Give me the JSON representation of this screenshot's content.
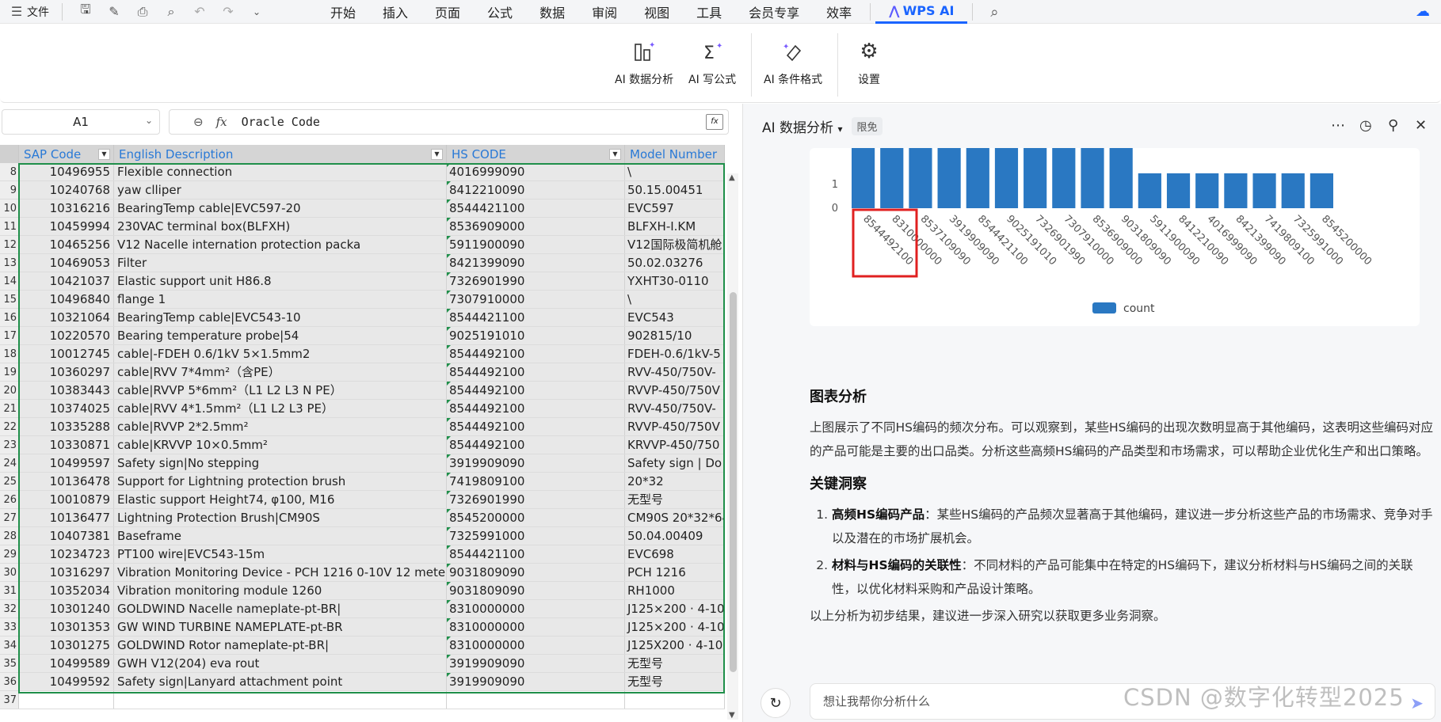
{
  "menubar": {
    "file_label": "文件",
    "tabs": [
      "开始",
      "插入",
      "页面",
      "公式",
      "数据",
      "审阅",
      "视图",
      "工具",
      "会员专享",
      "效率",
      "WPS AI"
    ],
    "active_tab": "WPS AI"
  },
  "ribbon": {
    "buttons": [
      {
        "label": "AI 数据分析",
        "icon": "ai-data-analysis-icon"
      },
      {
        "label": "AI 写公式",
        "icon": "ai-formula-icon"
      },
      {
        "label": "AI 条件格式",
        "icon": "ai-conditional-format-icon"
      },
      {
        "label": "设置",
        "icon": "gear-icon"
      }
    ]
  },
  "formula_bar": {
    "cell_ref": "A1",
    "fx_label": "fx",
    "value": "Oracle Code"
  },
  "sheet": {
    "columns": [
      "SAP Code",
      "English Description",
      "HS CODE",
      "Model Number"
    ],
    "rows": [
      {
        "n": "8",
        "sap": "10496955",
        "desc": "Flexible connection",
        "hs": "4016999090",
        "model": "\\"
      },
      {
        "n": "9",
        "sap": "10240768",
        "desc": "yaw clliper",
        "hs": "8412210090",
        "model": "50.15.00451"
      },
      {
        "n": "10",
        "sap": "10316216",
        "desc": "BearingTemp cable|EVC597-20",
        "hs": "8544421100",
        "model": "EVC597"
      },
      {
        "n": "11",
        "sap": "10459994",
        "desc": "230VAC terminal box(BLFXH)",
        "hs": "8536909000",
        "model": "BLFXH-Ⅰ.KM"
      },
      {
        "n": "12",
        "sap": "10465256",
        "desc": "V12 Nacelle internation protection packa",
        "hs": "5911900090",
        "model": "V12国际极简机舱"
      },
      {
        "n": "13",
        "sap": "10469053",
        "desc": "Filter",
        "hs": "8421399090",
        "model": "50.02.03276"
      },
      {
        "n": "14",
        "sap": "10421037",
        "desc": "Elastic support unit H86.8",
        "hs": "7326901990",
        "model": "YXHT30-0110"
      },
      {
        "n": "15",
        "sap": "10496840",
        "desc": "flange 1",
        "hs": "7307910000",
        "model": "\\"
      },
      {
        "n": "16",
        "sap": "10321064",
        "desc": "BearingTemp cable|EVC543-10",
        "hs": "8544421100",
        "model": "EVC543"
      },
      {
        "n": "17",
        "sap": "10220570",
        "desc": "Bearing temperature probe|54",
        "hs": "9025191010",
        "model": "902815/10"
      },
      {
        "n": "18",
        "sap": "10012745",
        "desc": "cable|-FDEH 0.6/1kV 5×1.5mm2",
        "hs": "8544492100",
        "model": "FDEH-0.6/1kV-5"
      },
      {
        "n": "19",
        "sap": "10360297",
        "desc": "cable|RVV 7*4mm²（含PE）",
        "hs": "8544492100",
        "model": "RVV-450/750V-"
      },
      {
        "n": "20",
        "sap": "10383443",
        "desc": "cable|RVVP 5*6mm²（L1 L2 L3 N PE）",
        "hs": "8544492100",
        "model": "RVVP-450/750V"
      },
      {
        "n": "21",
        "sap": "10374025",
        "desc": "cable|RVV 4*1.5mm²（L1 L2 L3 PE）",
        "hs": "8544492100",
        "model": "RVV-450/750V-"
      },
      {
        "n": "22",
        "sap": "10335288",
        "desc": "cable|RVVP 2*2.5mm²",
        "hs": "8544492100",
        "model": "RVVP-450/750V"
      },
      {
        "n": "23",
        "sap": "10330871",
        "desc": "cable|KRVVP 10×0.5mm²",
        "hs": "8544492100",
        "model": "KRVVP-450/750"
      },
      {
        "n": "24",
        "sap": "10499597",
        "desc": "Safety sign|No stepping",
        "hs": "3919909090",
        "model": "Safety sign | Do"
      },
      {
        "n": "25",
        "sap": "10136478",
        "desc": "Support for Lightning protection brush",
        "hs": "7419809100",
        "model": "20*32"
      },
      {
        "n": "26",
        "sap": "10010879",
        "desc": "Elastic support Height74, φ100, M16",
        "hs": "7326901990",
        "model": "无型号"
      },
      {
        "n": "27",
        "sap": "10136477",
        "desc": "Lightning Protection Brush|CM90S",
        "hs": "8545200000",
        "model": "CM90S 20*32*64"
      },
      {
        "n": "28",
        "sap": "10407381",
        "desc": "Baseframe",
        "hs": "7325991000",
        "model": "50.04.00409"
      },
      {
        "n": "29",
        "sap": "10234723",
        "desc": "PT100 wire|EVC543-15m",
        "hs": "8544421100",
        "model": "EVC698"
      },
      {
        "n": "30",
        "sap": "10316297",
        "desc": "Vibration Monitoring Device - PCH 1216 0-10V 12 mete",
        "hs": "9031809090",
        "model": "PCH 1216"
      },
      {
        "n": "31",
        "sap": "10352034",
        "desc": "Vibration monitoring module 1260",
        "hs": "9031809090",
        "model": "RH1000"
      },
      {
        "n": "32",
        "sap": "10301240",
        "desc": "GOLDWIND Nacelle nameplate-pt-BR|",
        "hs": "8310000000",
        "model": "J125×200 · 4-10"
      },
      {
        "n": "33",
        "sap": "10301353",
        "desc": "GW WIND TURBINE NAMEPLATE-pt-BR",
        "hs": "8310000000",
        "model": "J125×200 · 4-10"
      },
      {
        "n": "34",
        "sap": "10301275",
        "desc": "GOLDWIND Rotor nameplate-pt-BR|",
        "hs": "8310000000",
        "model": "J125X200 · 4-10"
      },
      {
        "n": "35",
        "sap": "10499589",
        "desc": "GWH V12(204) eva rout",
        "hs": "3919909090",
        "model": "无型号"
      },
      {
        "n": "36",
        "sap": "10499592",
        "desc": "Safety sign|Lanyard attachment point",
        "hs": "3919909090",
        "model": "无型号"
      },
      {
        "n": "37",
        "sap": "",
        "desc": "",
        "hs": "",
        "model": ""
      }
    ]
  },
  "ai_panel": {
    "title": "AI 数据分析",
    "badge": "限免",
    "input_placeholder": "想让我帮你分析什么",
    "analysis_title": "图表分析",
    "analysis_text": "上图展示了不同HS编码的频次分布。可以观察到，某些HS编码的出现次数明显高于其他编码，这表明这些编码对应的产品可能是主要的出口品类。分析这些高频HS编码的产品类型和市场需求，可以帮助企业优化生产和出口策略。",
    "insights_title": "关键洞察",
    "insights": [
      {
        "bold": "高频HS编码产品",
        "text": "：某些HS编码的产品频次显著高于其他编码，建议进一步分析这些产品的市场需求、竞争对手以及潜在的市场扩展机会。"
      },
      {
        "bold": "材料与HS编码的关联性",
        "text": "：不同材料的产品可能集中在特定的HS编码下，建议分析材料与HS编码之间的关联性，以优化材料采购和产品设计策略。"
      }
    ],
    "conclusion": "以上分析为初步结果，建议进一步深入研究以获取更多业务洞察。"
  },
  "chart_data": {
    "type": "bar",
    "categories": [
      "8544492100",
      "8310000000",
      "8537109090",
      "3919909090",
      "8544421100",
      "9025191010",
      "7326901990",
      "7307910000",
      "8536909000",
      "9031809090",
      "5911900090",
      "8412210090",
      "4016999090",
      "8421399090",
      "7419809100",
      "7325991000",
      "8545200000"
    ],
    "series": [
      {
        "name": "count",
        "values": [
          2,
          2,
          2,
          2,
          2,
          2,
          2,
          2,
          2,
          2,
          1,
          1,
          1,
          1,
          1,
          1,
          1
        ]
      }
    ],
    "y_ticks": [
      "0",
      "1"
    ],
    "legend": "bottom-center",
    "highlighted_category": "8544492100",
    "colors": {
      "bar": "#2a78c2",
      "highlight": "#e02020"
    }
  },
  "watermark": "CSDN @数字化转型2025"
}
